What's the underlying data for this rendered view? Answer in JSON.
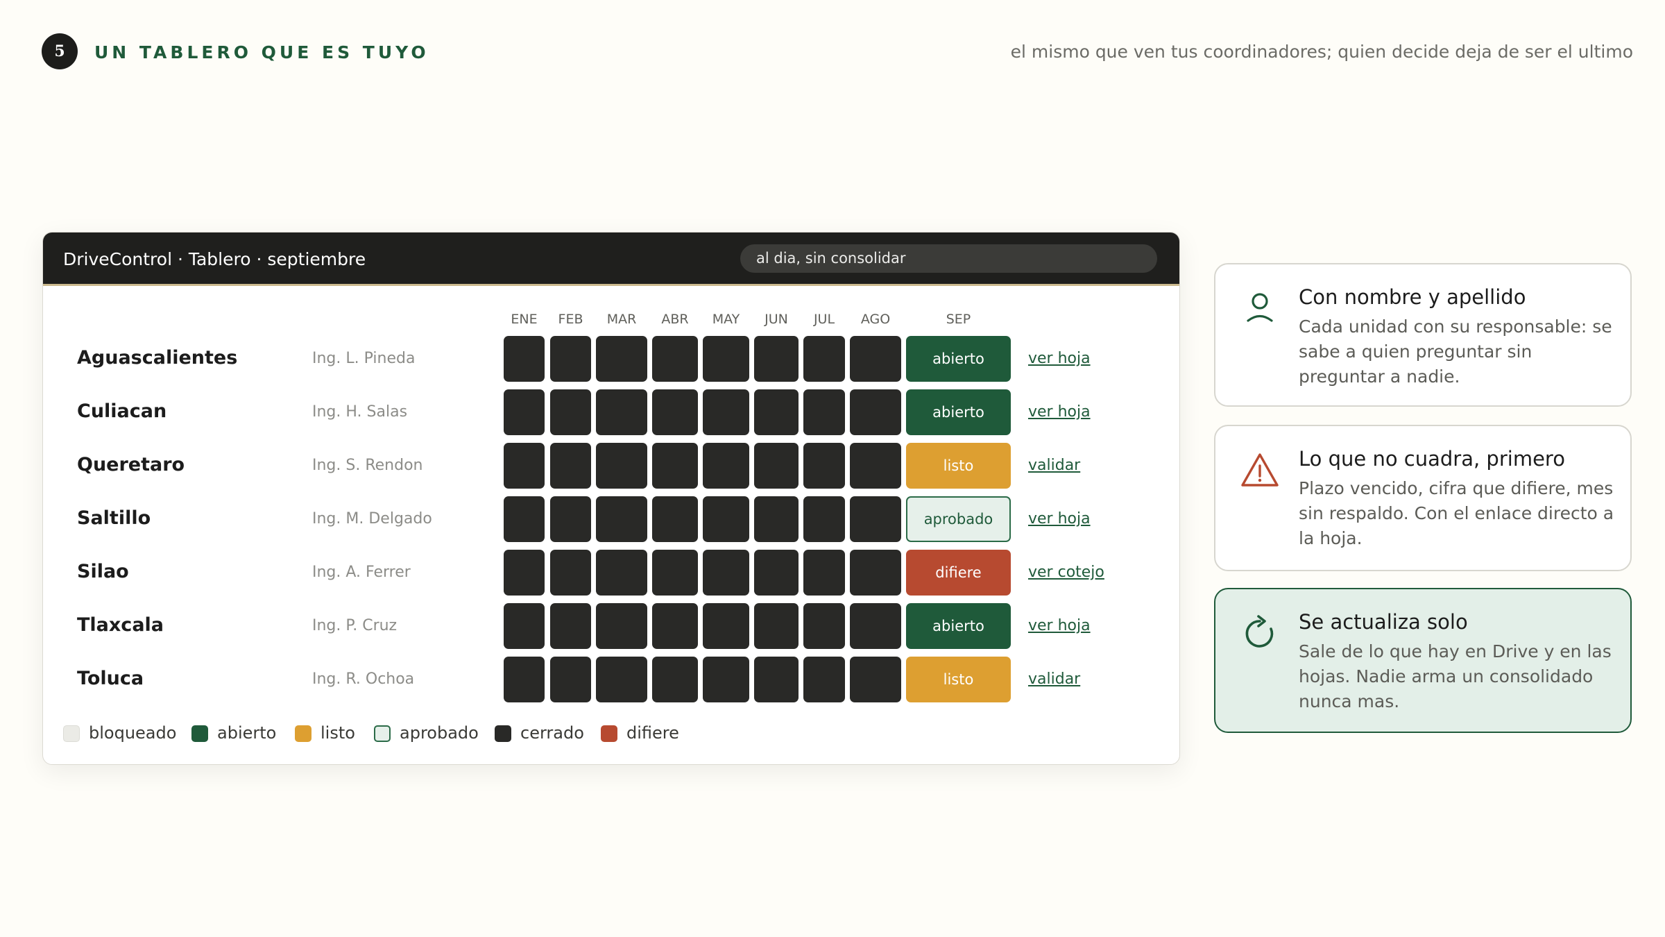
{
  "slide": {
    "number": "5",
    "title": "UN TABLERO QUE ES TUYO",
    "tagline": "el mismo que ven tus coordinadores; quien decide deja de ser el ultimo"
  },
  "window": {
    "title": "DriveControl · Tablero · septiembre",
    "status": "al dia, sin consolidar"
  },
  "months": [
    "ENE",
    "FEB",
    "MAR",
    "ABR",
    "MAY",
    "JUN",
    "JUL",
    "AGO",
    "SEP"
  ],
  "rows": [
    {
      "region": "Aguascalientes",
      "engineer": "Ing. L. Pineda",
      "sep": "abierto",
      "action": "ver hoja"
    },
    {
      "region": "Culiacan",
      "engineer": "Ing. H. Salas",
      "sep": "abierto",
      "action": "ver hoja"
    },
    {
      "region": "Queretaro",
      "engineer": "Ing. S. Rendon",
      "sep": "listo",
      "action": "validar"
    },
    {
      "region": "Saltillo",
      "engineer": "Ing. M. Delgado",
      "sep": "aprobado",
      "action": "ver hoja"
    },
    {
      "region": "Silao",
      "engineer": "Ing. A. Ferrer",
      "sep": "difiere",
      "action": "ver cotejo"
    },
    {
      "region": "Tlaxcala",
      "engineer": "Ing. P. Cruz",
      "sep": "abierto",
      "action": "ver hoja"
    },
    {
      "region": "Toluca",
      "engineer": "Ing. R. Ochoa",
      "sep": "listo",
      "action": "validar"
    }
  ],
  "legend": [
    {
      "label": "bloqueado",
      "color": "#ebebe6"
    },
    {
      "label": "abierto",
      "color": "#1f5a3a"
    },
    {
      "label": "listo",
      "color": "#dd9f31"
    },
    {
      "label": "aprobado",
      "color": "#e6f0ea"
    },
    {
      "label": "cerrado",
      "color": "#292927"
    },
    {
      "label": "difiere",
      "color": "#b74a30"
    }
  ],
  "cards": [
    {
      "title": "Con nombre y apellido",
      "body": "Cada unidad con su responsable: se sabe a quien preguntar sin preguntar a nadie.",
      "icon": "person-icon"
    },
    {
      "title": "Lo que no cuadra, primero",
      "body": "Plazo vencido, cifra que difiere, mes sin respaldo. Con el enlace directo a la hoja.",
      "icon": "warning-icon"
    },
    {
      "title": "Se actualiza solo",
      "body": "Sale de lo que hay en Drive y en las hojas. Nadie arma un consolidado nunca mas.",
      "icon": "refresh-icon"
    }
  ]
}
